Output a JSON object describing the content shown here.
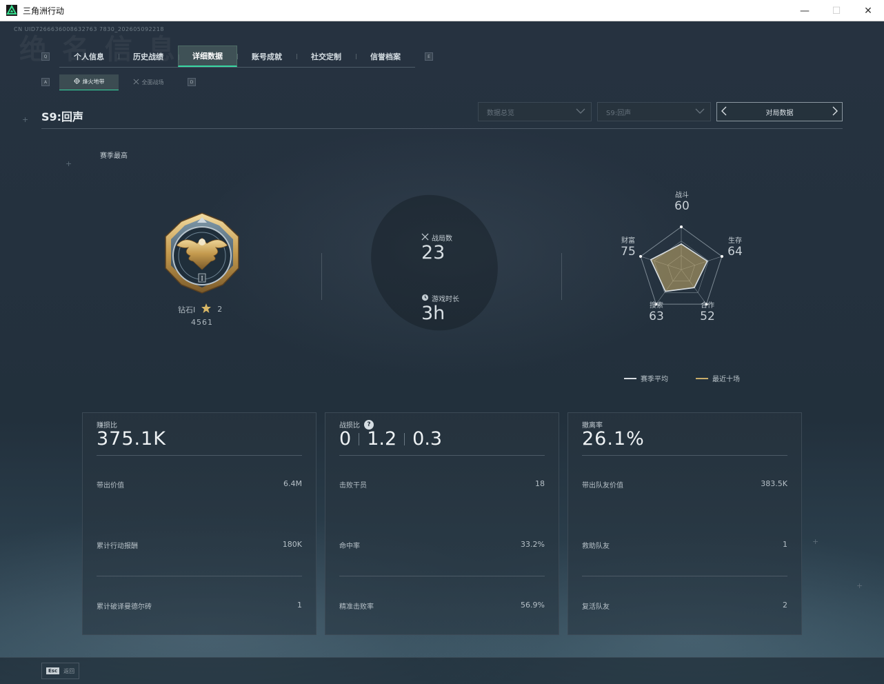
{
  "window": {
    "title": "三角洲行动",
    "controls": {
      "minimize": "—",
      "maximize": "☐",
      "close": "✕"
    }
  },
  "uid": "CN UID7266636008632763 7830_202605092218",
  "watermark": "绝 名 信 息",
  "tabs": {
    "left_key": "Q",
    "right_key": "E",
    "items": [
      {
        "label": "个人信息",
        "active": false
      },
      {
        "label": "历史战绩",
        "active": false
      },
      {
        "label": "详细数据",
        "active": true
      },
      {
        "label": "账号成就",
        "active": false
      },
      {
        "label": "社交定制",
        "active": false
      },
      {
        "label": "信誉档案",
        "active": false
      }
    ]
  },
  "sub_tabs": {
    "left_key": "A",
    "right_key": "D",
    "items": [
      {
        "label": "烽火地带",
        "active": true
      },
      {
        "label": "全面战场",
        "active": false
      }
    ]
  },
  "header": {
    "season_title": "S9:回声",
    "dropdown1": "数据总览",
    "dropdown2": "S9:回声",
    "match_button": "对局数据"
  },
  "season_best_label": "赛季最高",
  "rank": {
    "name": "钻石I",
    "stars": "2",
    "score": "4561"
  },
  "center_stats": {
    "matches_label": "战局数",
    "matches_value": "23",
    "playtime_label": "游戏时长",
    "playtime_value": "3h"
  },
  "radar": {
    "axes": [
      {
        "label": "战斗",
        "value": "60"
      },
      {
        "label": "生存",
        "value": "64"
      },
      {
        "label": "合作",
        "value": "52"
      },
      {
        "label": "搜索",
        "value": "63"
      },
      {
        "label": "财富",
        "value": "75"
      }
    ],
    "legend": {
      "avg": "赛季平均",
      "recent": "最近十场"
    },
    "colors": {
      "avg": "#d7dde1",
      "recent": "#c9ad6a"
    }
  },
  "cards": [
    {
      "label": "赚损比",
      "big": "375.1K",
      "rows": [
        {
          "label": "带出价值",
          "value": "6.4M"
        },
        {
          "label": "累计行动报酬",
          "value": "180K"
        },
        {
          "label": "累计破译曼德尔砖",
          "value": "1"
        }
      ]
    },
    {
      "label": "战损比",
      "question": "?",
      "kd": [
        "0",
        "1.2",
        "0.3"
      ],
      "rows": [
        {
          "label": "击败干员",
          "value": "18"
        },
        {
          "label": "命中率",
          "value": "33.2%"
        },
        {
          "label": "精准击败率",
          "value": "56.9%"
        }
      ]
    },
    {
      "label": "撤离率",
      "big": "26.1%",
      "rows": [
        {
          "label": "带出队友价值",
          "value": "383.5K"
        },
        {
          "label": "救助队友",
          "value": "1"
        },
        {
          "label": "复活队友",
          "value": "2"
        }
      ]
    }
  ],
  "bottom": {
    "esc_key": "Esc",
    "back_label": "返回"
  },
  "accent_color": "#38d8a2"
}
